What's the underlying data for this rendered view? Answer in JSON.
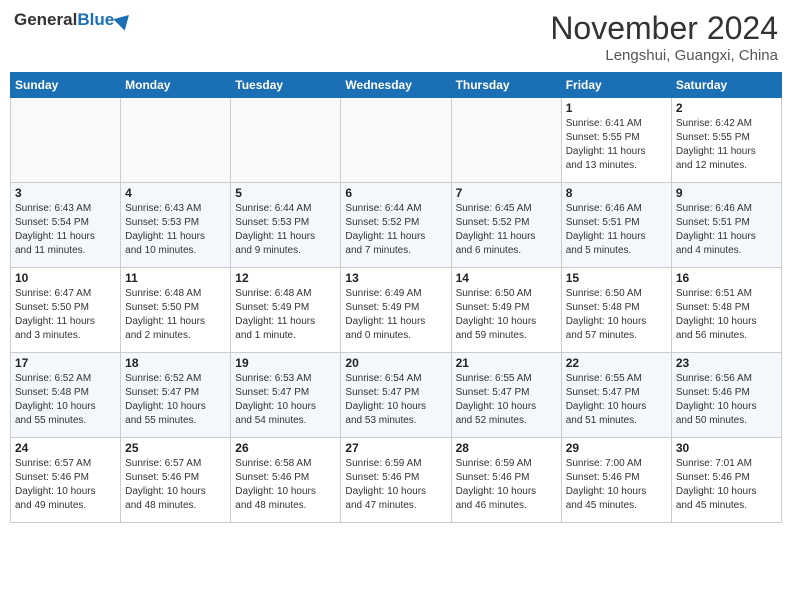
{
  "header": {
    "logo_general": "General",
    "logo_blue": "Blue",
    "month": "November 2024",
    "location": "Lengshui, Guangxi, China"
  },
  "days_of_week": [
    "Sunday",
    "Monday",
    "Tuesday",
    "Wednesday",
    "Thursday",
    "Friday",
    "Saturday"
  ],
  "weeks": [
    [
      {
        "num": "",
        "info": ""
      },
      {
        "num": "",
        "info": ""
      },
      {
        "num": "",
        "info": ""
      },
      {
        "num": "",
        "info": ""
      },
      {
        "num": "",
        "info": ""
      },
      {
        "num": "1",
        "info": "Sunrise: 6:41 AM\nSunset: 5:55 PM\nDaylight: 11 hours\nand 13 minutes."
      },
      {
        "num": "2",
        "info": "Sunrise: 6:42 AM\nSunset: 5:55 PM\nDaylight: 11 hours\nand 12 minutes."
      }
    ],
    [
      {
        "num": "3",
        "info": "Sunrise: 6:43 AM\nSunset: 5:54 PM\nDaylight: 11 hours\nand 11 minutes."
      },
      {
        "num": "4",
        "info": "Sunrise: 6:43 AM\nSunset: 5:53 PM\nDaylight: 11 hours\nand 10 minutes."
      },
      {
        "num": "5",
        "info": "Sunrise: 6:44 AM\nSunset: 5:53 PM\nDaylight: 11 hours\nand 9 minutes."
      },
      {
        "num": "6",
        "info": "Sunrise: 6:44 AM\nSunset: 5:52 PM\nDaylight: 11 hours\nand 7 minutes."
      },
      {
        "num": "7",
        "info": "Sunrise: 6:45 AM\nSunset: 5:52 PM\nDaylight: 11 hours\nand 6 minutes."
      },
      {
        "num": "8",
        "info": "Sunrise: 6:46 AM\nSunset: 5:51 PM\nDaylight: 11 hours\nand 5 minutes."
      },
      {
        "num": "9",
        "info": "Sunrise: 6:46 AM\nSunset: 5:51 PM\nDaylight: 11 hours\nand 4 minutes."
      }
    ],
    [
      {
        "num": "10",
        "info": "Sunrise: 6:47 AM\nSunset: 5:50 PM\nDaylight: 11 hours\nand 3 minutes."
      },
      {
        "num": "11",
        "info": "Sunrise: 6:48 AM\nSunset: 5:50 PM\nDaylight: 11 hours\nand 2 minutes."
      },
      {
        "num": "12",
        "info": "Sunrise: 6:48 AM\nSunset: 5:49 PM\nDaylight: 11 hours\nand 1 minute."
      },
      {
        "num": "13",
        "info": "Sunrise: 6:49 AM\nSunset: 5:49 PM\nDaylight: 11 hours\nand 0 minutes."
      },
      {
        "num": "14",
        "info": "Sunrise: 6:50 AM\nSunset: 5:49 PM\nDaylight: 10 hours\nand 59 minutes."
      },
      {
        "num": "15",
        "info": "Sunrise: 6:50 AM\nSunset: 5:48 PM\nDaylight: 10 hours\nand 57 minutes."
      },
      {
        "num": "16",
        "info": "Sunrise: 6:51 AM\nSunset: 5:48 PM\nDaylight: 10 hours\nand 56 minutes."
      }
    ],
    [
      {
        "num": "17",
        "info": "Sunrise: 6:52 AM\nSunset: 5:48 PM\nDaylight: 10 hours\nand 55 minutes."
      },
      {
        "num": "18",
        "info": "Sunrise: 6:52 AM\nSunset: 5:47 PM\nDaylight: 10 hours\nand 55 minutes."
      },
      {
        "num": "19",
        "info": "Sunrise: 6:53 AM\nSunset: 5:47 PM\nDaylight: 10 hours\nand 54 minutes."
      },
      {
        "num": "20",
        "info": "Sunrise: 6:54 AM\nSunset: 5:47 PM\nDaylight: 10 hours\nand 53 minutes."
      },
      {
        "num": "21",
        "info": "Sunrise: 6:55 AM\nSunset: 5:47 PM\nDaylight: 10 hours\nand 52 minutes."
      },
      {
        "num": "22",
        "info": "Sunrise: 6:55 AM\nSunset: 5:47 PM\nDaylight: 10 hours\nand 51 minutes."
      },
      {
        "num": "23",
        "info": "Sunrise: 6:56 AM\nSunset: 5:46 PM\nDaylight: 10 hours\nand 50 minutes."
      }
    ],
    [
      {
        "num": "24",
        "info": "Sunrise: 6:57 AM\nSunset: 5:46 PM\nDaylight: 10 hours\nand 49 minutes."
      },
      {
        "num": "25",
        "info": "Sunrise: 6:57 AM\nSunset: 5:46 PM\nDaylight: 10 hours\nand 48 minutes."
      },
      {
        "num": "26",
        "info": "Sunrise: 6:58 AM\nSunset: 5:46 PM\nDaylight: 10 hours\nand 48 minutes."
      },
      {
        "num": "27",
        "info": "Sunrise: 6:59 AM\nSunset: 5:46 PM\nDaylight: 10 hours\nand 47 minutes."
      },
      {
        "num": "28",
        "info": "Sunrise: 6:59 AM\nSunset: 5:46 PM\nDaylight: 10 hours\nand 46 minutes."
      },
      {
        "num": "29",
        "info": "Sunrise: 7:00 AM\nSunset: 5:46 PM\nDaylight: 10 hours\nand 45 minutes."
      },
      {
        "num": "30",
        "info": "Sunrise: 7:01 AM\nSunset: 5:46 PM\nDaylight: 10 hours\nand 45 minutes."
      }
    ]
  ]
}
